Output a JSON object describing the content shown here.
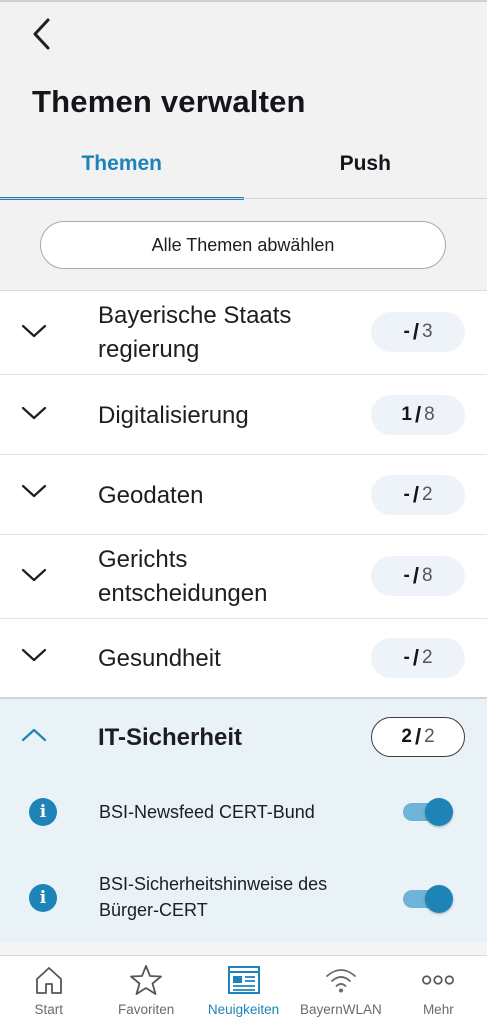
{
  "header": {
    "title": "Themen verwalten",
    "back_icon": "chevron-left-icon"
  },
  "tabs": [
    {
      "label": "Themen",
      "active": true
    },
    {
      "label": "Push",
      "active": false
    }
  ],
  "deselect_all_label": "Alle Themen abwählen",
  "topics": [
    {
      "label_lines": [
        "Bayerische Staats",
        "regierung"
      ],
      "selected": "-",
      "total": "3",
      "expanded": false
    },
    {
      "label_lines": [
        "Digitalisierung"
      ],
      "selected": "1",
      "total": "8",
      "expanded": false
    },
    {
      "label_lines": [
        "Geodaten"
      ],
      "selected": "-",
      "total": "2",
      "expanded": false
    },
    {
      "label_lines": [
        "Gerichts",
        "entscheidungen"
      ],
      "selected": "-",
      "total": "8",
      "expanded": false
    },
    {
      "label_lines": [
        "Gesundheit"
      ],
      "selected": "-",
      "total": "2",
      "expanded": false
    },
    {
      "label_lines": [
        "IT-Sicherheit"
      ],
      "selected": "2",
      "total": "2",
      "expanded": true
    }
  ],
  "subtopics": [
    {
      "label_lines": [
        "BSI-Newsfeed CERT-Bund"
      ],
      "enabled": true
    },
    {
      "label_lines": [
        "BSI-Sicherheitshinweise des",
        "Bürger-CERT"
      ],
      "enabled": true
    }
  ],
  "bottom_nav": [
    {
      "label": "Start",
      "icon": "home-icon",
      "active": false
    },
    {
      "label": "Favoriten",
      "icon": "star-icon",
      "active": false
    },
    {
      "label": "Neuigkeiten",
      "icon": "newspaper-icon",
      "active": true
    },
    {
      "label": "BayernWLAN",
      "icon": "wifi-icon",
      "active": false
    },
    {
      "label": "Mehr",
      "icon": "more-dots-icon",
      "active": false
    }
  ],
  "colors": {
    "accent": "#1e84b7",
    "expanded_bg": "#e9f2f7",
    "badge_bg": "#edf3f8"
  }
}
